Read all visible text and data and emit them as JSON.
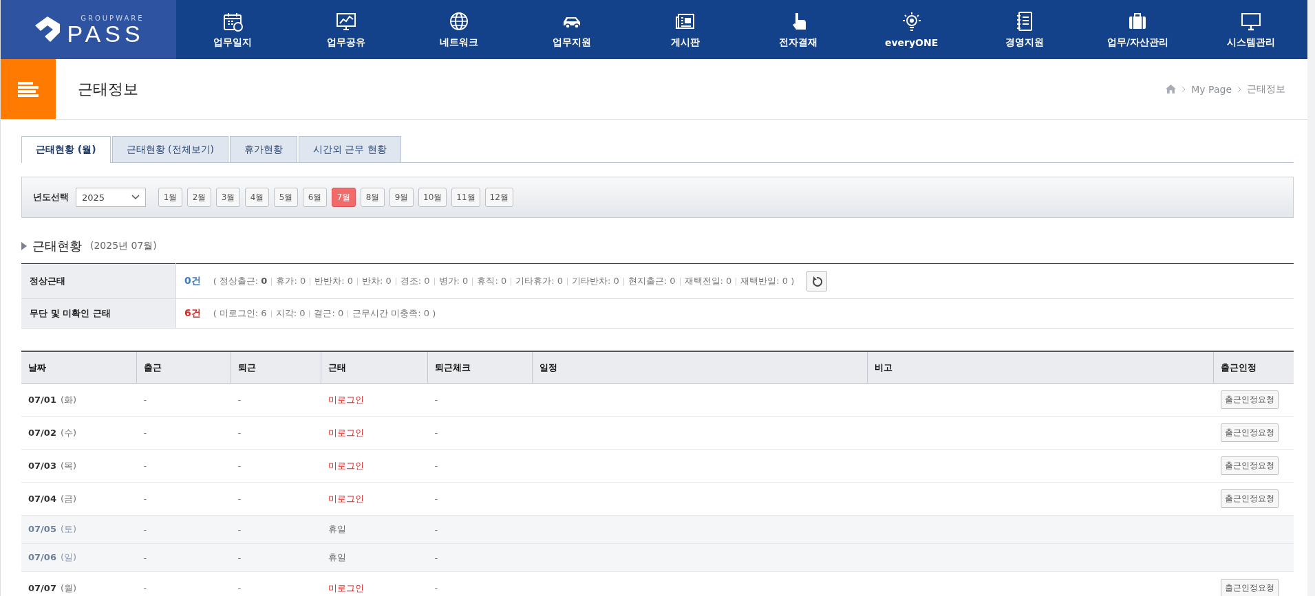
{
  "header": {
    "logo": {
      "small": "GROUPWARE",
      "main": "PASS"
    },
    "nav": [
      {
        "label": "업무일지"
      },
      {
        "label": "업무공유"
      },
      {
        "label": "네트워크"
      },
      {
        "label": "업무지원"
      },
      {
        "label": "게시판"
      },
      {
        "label": "전자결재"
      },
      {
        "label": "everyONE"
      },
      {
        "label": "경영지원"
      },
      {
        "label": "업무/자산관리"
      },
      {
        "label": "시스템관리"
      }
    ]
  },
  "page_title": "근태정보",
  "breadcrumb": [
    "My Page",
    "근태정보"
  ],
  "tabs": [
    {
      "label": "근태현황 (월)",
      "selected": true
    },
    {
      "label": "근태현황 (전체보기)",
      "selected": false
    },
    {
      "label": "휴가현황",
      "selected": false
    },
    {
      "label": "시간외 근무 현황",
      "selected": false
    }
  ],
  "filter": {
    "label": "년도선택",
    "year": "2025",
    "months": [
      {
        "label": "1월",
        "selected": false
      },
      {
        "label": "2월",
        "selected": false
      },
      {
        "label": "3월",
        "selected": false
      },
      {
        "label": "4월",
        "selected": false
      },
      {
        "label": "5월",
        "selected": false
      },
      {
        "label": "6월",
        "selected": false
      },
      {
        "label": "7월",
        "selected": true
      },
      {
        "label": "8월",
        "selected": false
      },
      {
        "label": "9월",
        "selected": false
      },
      {
        "label": "10월",
        "selected": false
      },
      {
        "label": "11월",
        "selected": false
      },
      {
        "label": "12월",
        "selected": false
      }
    ]
  },
  "section": {
    "title": "근태현황",
    "period": "(2025년 07월)"
  },
  "summary": [
    {
      "label": "정상근태",
      "count": "0건",
      "kind": "normal",
      "open": "(",
      "close": ")",
      "refresh": true,
      "items": [
        "정상출근: **0**",
        "휴가: 0",
        "반반차: 0",
        "반차: 0",
        "경조: 0",
        "병가: 0",
        "휴직: 0",
        "기타휴가: 0",
        "기타반차: 0",
        "현지출근: 0",
        "재택전일: 0",
        "재택반일: 0"
      ]
    },
    {
      "label": "무단 및 미확인 근태",
      "count": "6건",
      "kind": "warning",
      "open": "(",
      "close": ")",
      "refresh": false,
      "items": [
        "미로그인: 6",
        "지각: 0",
        "결근: 0",
        "근무시간 미충족: 0"
      ]
    }
  ],
  "table": {
    "columns": [
      "날짜",
      "출근",
      "퇴근",
      "근태",
      "퇴근체크",
      "일정",
      "비고",
      "출근인정"
    ],
    "rows": [
      {
        "date": "07/01",
        "weekday": "(화)",
        "weekend": false,
        "in": "-",
        "out": "-",
        "status": "미로그인",
        "kind": "absent",
        "check": "-",
        "action": "출근인정요청"
      },
      {
        "date": "07/02",
        "weekday": "(수)",
        "weekend": false,
        "in": "-",
        "out": "-",
        "status": "미로그인",
        "kind": "absent",
        "check": "-",
        "action": "출근인정요청"
      },
      {
        "date": "07/03",
        "weekday": "(목)",
        "weekend": false,
        "in": "-",
        "out": "-",
        "status": "미로그인",
        "kind": "absent",
        "check": "-",
        "action": "출근인정요청"
      },
      {
        "date": "07/04",
        "weekday": "(금)",
        "weekend": false,
        "in": "-",
        "out": "-",
        "status": "미로그인",
        "kind": "absent",
        "check": "-",
        "action": "출근인정요청"
      },
      {
        "date": "07/05",
        "weekday": "(토)",
        "weekend": true,
        "in": "-",
        "out": "-",
        "status": "휴일",
        "kind": "holiday",
        "check": "-"
      },
      {
        "date": "07/06",
        "weekday": "(일)",
        "weekend": true,
        "in": "-",
        "out": "-",
        "status": "휴일",
        "kind": "holiday",
        "check": "-"
      },
      {
        "date": "07/07",
        "weekday": "(월)",
        "weekend": false,
        "in": "-",
        "out": "-",
        "status": "미로그인",
        "kind": "absent",
        "check": "-",
        "action": "출근인정요청"
      }
    ]
  }
}
